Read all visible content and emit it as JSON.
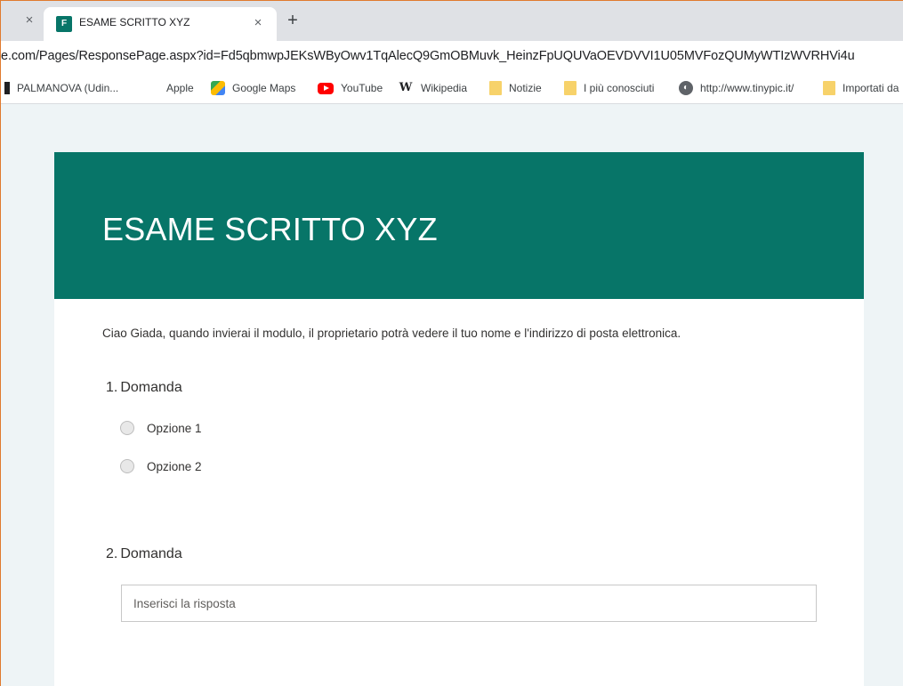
{
  "browser": {
    "tab": {
      "title": "ESAME SCRITTO XYZ",
      "favicon": "F",
      "close": "×"
    },
    "left_close": "×",
    "new_tab": "+",
    "url": "e.com/Pages/ResponsePage.aspx?id=Fd5qbmwpJEKsWByOwv1TqAlecQ9GmOBMuvk_HeinzFpUQUVaOEVDVVI1U05MVFozQUMyWTIzWVRHVi4u",
    "bookmarks": [
      {
        "label": "PALMANOVA (Udin...",
        "icon": "palmanova-icon"
      },
      {
        "label": "Apple",
        "icon": "apple-icon"
      },
      {
        "label": "Google Maps",
        "icon": "google-maps-icon"
      },
      {
        "label": "YouTube",
        "icon": "youtube-icon"
      },
      {
        "label": "Wikipedia",
        "icon": "wikipedia-icon"
      },
      {
        "label": "Notizie",
        "icon": "folder-icon"
      },
      {
        "label": "I più conosciuti",
        "icon": "folder-icon"
      },
      {
        "label": "http://www.tinypic.it/",
        "icon": "globe-icon"
      },
      {
        "label": "Importati da",
        "icon": "folder-icon"
      }
    ],
    "apple_glyph": "",
    "wiki_glyph": "W",
    "globe_glyph": "◐"
  },
  "form": {
    "title": "ESAME SCRITTO XYZ",
    "notice": "Ciao Giada, quando invierai il modulo, il proprietario potrà vedere il tuo nome e l'indirizzo di posta elettronica.",
    "questions": [
      {
        "number": "1.",
        "label": "Domanda",
        "options": [
          "Opzione 1",
          "Opzione 2"
        ]
      },
      {
        "number": "2.",
        "label": "Domanda",
        "placeholder": "Inserisci la risposta"
      }
    ]
  },
  "colors": {
    "banner": "#077568",
    "page_background": "#eef4f6"
  }
}
